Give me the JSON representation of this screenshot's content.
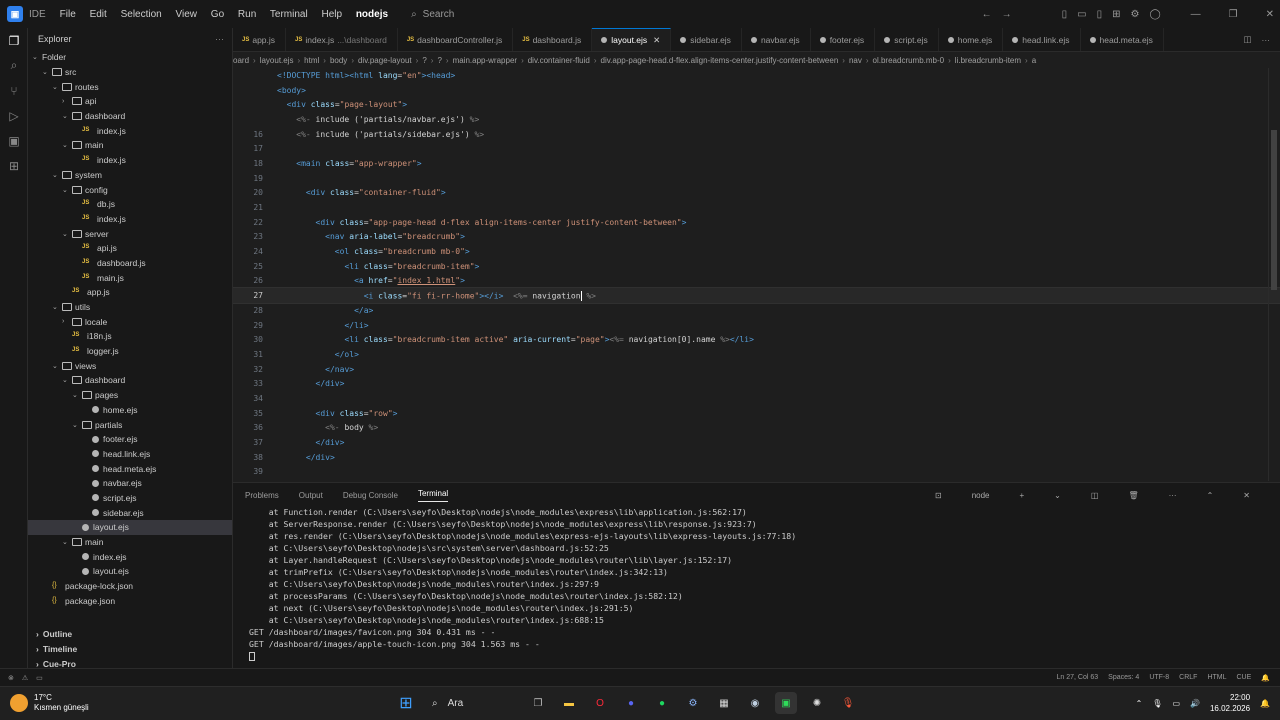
{
  "titlebar": {
    "app_name": "IDE",
    "menus": [
      "File",
      "Edit",
      "Selection",
      "View",
      "Go",
      "Run",
      "Terminal",
      "Help"
    ],
    "project": "nodejs",
    "search_placeholder": "Search"
  },
  "sidebar": {
    "title": "Explorer",
    "root": "Folder",
    "tree": [
      {
        "label": "src",
        "kind": "folder",
        "depth": 0
      },
      {
        "label": "routes",
        "kind": "folder",
        "depth": 1
      },
      {
        "label": "api",
        "kind": "folder-closed",
        "depth": 2
      },
      {
        "label": "dashboard",
        "kind": "folder",
        "depth": 2
      },
      {
        "label": "index.js",
        "kind": "js",
        "depth": 3
      },
      {
        "label": "main",
        "kind": "folder",
        "depth": 2
      },
      {
        "label": "index.js",
        "kind": "js",
        "depth": 3
      },
      {
        "label": "system",
        "kind": "folder",
        "depth": 1
      },
      {
        "label": "config",
        "kind": "folder",
        "depth": 2
      },
      {
        "label": "db.js",
        "kind": "js",
        "depth": 3
      },
      {
        "label": "index.js",
        "kind": "js",
        "depth": 3
      },
      {
        "label": "server",
        "kind": "folder",
        "depth": 2
      },
      {
        "label": "api.js",
        "kind": "js",
        "depth": 3
      },
      {
        "label": "dashboard.js",
        "kind": "js",
        "depth": 3
      },
      {
        "label": "main.js",
        "kind": "js",
        "depth": 3
      },
      {
        "label": "app.js",
        "kind": "js",
        "depth": 2
      },
      {
        "label": "utils",
        "kind": "folder",
        "depth": 1
      },
      {
        "label": "locale",
        "kind": "folder-closed",
        "depth": 2
      },
      {
        "label": "i18n.js",
        "kind": "js",
        "depth": 2
      },
      {
        "label": "logger.js",
        "kind": "js",
        "depth": 2
      },
      {
        "label": "views",
        "kind": "folder",
        "depth": 1
      },
      {
        "label": "dashboard",
        "kind": "folder",
        "depth": 2
      },
      {
        "label": "pages",
        "kind": "folder",
        "depth": 3
      },
      {
        "label": "home.ejs",
        "kind": "ejs",
        "depth": 4
      },
      {
        "label": "partials",
        "kind": "folder",
        "depth": 3
      },
      {
        "label": "footer.ejs",
        "kind": "ejs",
        "depth": 4
      },
      {
        "label": "head.link.ejs",
        "kind": "ejs",
        "depth": 4
      },
      {
        "label": "head.meta.ejs",
        "kind": "ejs",
        "depth": 4
      },
      {
        "label": "navbar.ejs",
        "kind": "ejs",
        "depth": 4
      },
      {
        "label": "script.ejs",
        "kind": "ejs",
        "depth": 4
      },
      {
        "label": "sidebar.ejs",
        "kind": "ejs",
        "depth": 4
      },
      {
        "label": "layout.ejs",
        "kind": "ejs",
        "depth": 3,
        "selected": true
      },
      {
        "label": "main",
        "kind": "folder",
        "depth": 2
      },
      {
        "label": "index.ejs",
        "kind": "ejs",
        "depth": 3
      },
      {
        "label": "layout.ejs",
        "kind": "ejs",
        "depth": 3
      },
      {
        "label": "package-lock.json",
        "kind": "json",
        "depth": 0
      },
      {
        "label": "package.json",
        "kind": "json",
        "depth": 0
      }
    ],
    "bottom_sections": [
      "Outline",
      "Timeline",
      "Cue-Pro"
    ]
  },
  "tabs": [
    {
      "label": "app.js",
      "kind": "js"
    },
    {
      "label": "index.js",
      "kind": "js",
      "sub": "...\\dashboard"
    },
    {
      "label": "dashboardController.js",
      "kind": "js"
    },
    {
      "label": "dashboard.js",
      "kind": "js"
    },
    {
      "label": "layout.ejs",
      "kind": "ejs",
      "active": true
    },
    {
      "label": "sidebar.ejs",
      "kind": "ejs"
    },
    {
      "label": "navbar.ejs",
      "kind": "ejs"
    },
    {
      "label": "footer.ejs",
      "kind": "ejs"
    },
    {
      "label": "script.ejs",
      "kind": "ejs"
    },
    {
      "label": "home.ejs",
      "kind": "ejs"
    },
    {
      "label": "head.link.ejs",
      "kind": "ejs"
    },
    {
      "label": "head.meta.ejs",
      "kind": "ejs"
    }
  ],
  "breadcrumb": [
    "oard",
    "layout.ejs",
    "html",
    "body",
    "div.page-layout",
    "?",
    "?",
    "main.app-wrapper",
    "div.container-fluid",
    "div.app-page-head.d-flex.align-items-center.justify-content-between",
    "nav",
    "ol.breadcrumb.mb-0",
    "li.breadcrumb-item",
    "a"
  ],
  "editor": {
    "lines": [
      {
        "n": "",
        "html": "<span class='tg'>&lt;!DOCTYPE html&gt;&lt;html</span> <span class='at'>lang</span>=<span class='st'>\"en\"</span><span class='tg'>&gt;&lt;head&gt;</span>"
      },
      {
        "n": "",
        "html": "<span class='tg'>&lt;body&gt;</span>"
      },
      {
        "n": "",
        "html": "  <span class='tg'>&lt;div</span> <span class='at'>class</span>=<span class='st'>\"page-layout\"</span><span class='tg'>&gt;</span>"
      },
      {
        "n": "",
        "html": "    <span class='ps'>&lt;%-</span> include ('partials/navbar.ejs') <span class='ps'>%&gt;</span>"
      },
      {
        "n": "16",
        "html": "    <span class='ps'>&lt;%-</span> include ('partials/sidebar.ejs') <span class='ps'>%&gt;</span>"
      },
      {
        "n": "17",
        "html": ""
      },
      {
        "n": "18",
        "html": "    <span class='tg'>&lt;main</span> <span class='at'>class</span>=<span class='st'>\"app-wrapper\"</span><span class='tg'>&gt;</span>"
      },
      {
        "n": "19",
        "html": ""
      },
      {
        "n": "20",
        "html": "      <span class='tg'>&lt;div</span> <span class='at'>class</span>=<span class='st'>\"container-fluid\"</span><span class='tg'>&gt;</span>"
      },
      {
        "n": "21",
        "html": ""
      },
      {
        "n": "22",
        "html": "        <span class='tg'>&lt;div</span> <span class='at'>class</span>=<span class='st'>\"app-page-head d-flex align-items-center justify-content-between\"</span><span class='tg'>&gt;</span>"
      },
      {
        "n": "23",
        "html": "          <span class='tg'>&lt;nav</span> <span class='at'>aria-label</span>=<span class='st'>\"breadcrumb\"</span><span class='tg'>&gt;</span>"
      },
      {
        "n": "24",
        "html": "            <span class='tg'>&lt;ol</span> <span class='at'>class</span>=<span class='st'>\"breadcrumb mb-0\"</span><span class='tg'>&gt;</span>"
      },
      {
        "n": "25",
        "html": "              <span class='tg'>&lt;li</span> <span class='at'>class</span>=<span class='st'>\"breadcrumb-item\"</span><span class='tg'>&gt;</span>"
      },
      {
        "n": "26",
        "html": "                <span class='tg'>&lt;a</span> <span class='at'>href</span>=<span class='st'>\"<span class='ul'>index_1.html</span>\"</span><span class='tg'>&gt;</span>"
      },
      {
        "n": "27",
        "current": true,
        "html": "                  <span class='tg'>&lt;i</span> <span class='at'>class</span>=<span class='st'>\"fi fi-rr-home\"</span><span class='tg'>&gt;&lt;/i&gt;</span>  <span class='ps'>&lt;%=</span> navigation<span class='cursor'></span> <span class='ps'>%&gt;</span>"
      },
      {
        "n": "28",
        "html": "                <span class='tg'>&lt;/a&gt;</span>"
      },
      {
        "n": "29",
        "html": "              <span class='tg'>&lt;/li&gt;</span>"
      },
      {
        "n": "30",
        "html": "              <span class='tg'>&lt;li</span> <span class='at'>class</span>=<span class='st'>\"breadcrumb-item active\"</span> <span class='at'>aria-current</span>=<span class='st'>\"page\"</span><span class='tg'>&gt;</span><span class='ps'>&lt;%=</span> navigation[0].name <span class='ps'>%&gt;</span><span class='tg'>&lt;/li&gt;</span>"
      },
      {
        "n": "31",
        "html": "            <span class='tg'>&lt;/ol&gt;</span>"
      },
      {
        "n": "32",
        "html": "          <span class='tg'>&lt;/nav&gt;</span>"
      },
      {
        "n": "33",
        "html": "        <span class='tg'>&lt;/div&gt;</span>"
      },
      {
        "n": "34",
        "html": ""
      },
      {
        "n": "35",
        "html": "        <span class='tg'>&lt;div</span> <span class='at'>class</span>=<span class='st'>\"row\"</span><span class='tg'>&gt;</span>"
      },
      {
        "n": "36",
        "html": "          <span class='ps'>&lt;%-</span> body <span class='ps'>%&gt;</span>"
      },
      {
        "n": "37",
        "html": "        <span class='tg'>&lt;/div&gt;</span>"
      },
      {
        "n": "38",
        "html": "      <span class='tg'>&lt;/div&gt;</span>"
      },
      {
        "n": "39",
        "html": ""
      }
    ]
  },
  "panel": {
    "tabs": [
      "Problems",
      "Output",
      "Debug Console",
      "Terminal"
    ],
    "active_tab": "Terminal",
    "shell": "node",
    "terminal_lines": [
      "    at Function.render (C:\\Users\\seyfo\\Desktop\\nodejs\\node_modules\\express\\lib\\application.js:562:17)",
      "    at ServerResponse.render (C:\\Users\\seyfo\\Desktop\\nodejs\\node_modules\\express\\lib\\response.js:923:7)",
      "    at res.render (C:\\Users\\seyfo\\Desktop\\nodejs\\node_modules\\express-ejs-layouts\\lib\\express-layouts.js:77:18)",
      "    at C:\\Users\\seyfo\\Desktop\\nodejs\\src\\system\\server\\dashboard.js:52:25",
      "    at Layer.handleRequest (C:\\Users\\seyfo\\Desktop\\nodejs\\node_modules\\router\\lib\\layer.js:152:17)",
      "    at trimPrefix (C:\\Users\\seyfo\\Desktop\\nodejs\\node_modules\\router\\index.js:342:13)",
      "    at C:\\Users\\seyfo\\Desktop\\nodejs\\node_modules\\router\\index.js:297:9",
      "    at processParams (C:\\Users\\seyfo\\Desktop\\nodejs\\node_modules\\router\\index.js:582:12)",
      "    at next (C:\\Users\\seyfo\\Desktop\\nodejs\\node_modules\\router\\index.js:291:5)",
      "    at C:\\Users\\seyfo\\Desktop\\nodejs\\node_modules\\router\\index.js:688:15",
      "GET /dashboard/images/favicon.png 304 0.431 ms - -",
      "GET /dashboard/images/apple-touch-icon.png 304 1.563 ms - -"
    ]
  },
  "statusbar": {
    "position": "Ln 27, Col 63",
    "spaces": "Spaces: 4",
    "encoding": "UTF-8",
    "eol": "CRLF",
    "language": "HTML",
    "ext": "CUE"
  },
  "taskbar": {
    "temp": "17°C",
    "weather": "Kısmen güneşli",
    "search": "Ara",
    "time": "22:00",
    "date": "16.02.2026"
  }
}
